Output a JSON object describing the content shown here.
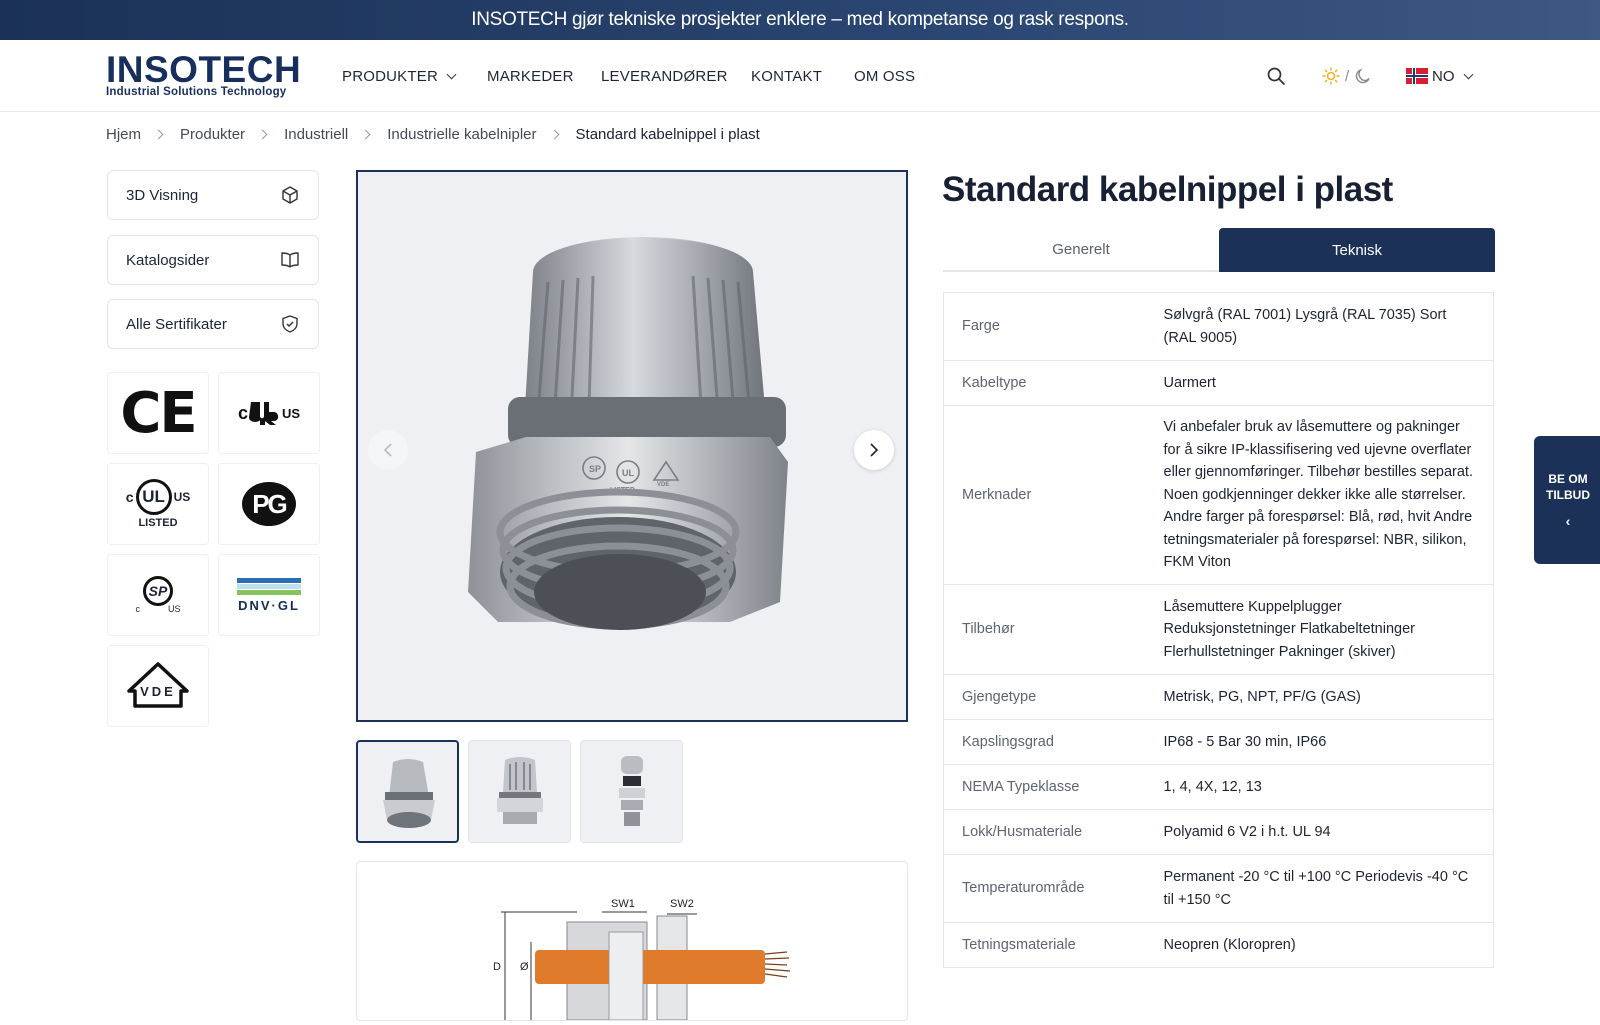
{
  "announcement": "INSOTECH gjør tekniske prosjekter enklere – med kompetanse og rask respons.",
  "logo": {
    "name": "INSOTECH",
    "tagline": "Industrial Solutions Technology"
  },
  "nav": {
    "products": "PRODUKTER",
    "markets": "MARKEDER",
    "suppliers": "LEVERANDØRER",
    "contact": "KONTAKT",
    "about": "OM OSS"
  },
  "theme_toggle": {
    "separator": "/"
  },
  "language": {
    "code": "NO"
  },
  "breadcrumb": [
    "Hjem",
    "Produkter",
    "Industriell",
    "Industrielle kabelnipler",
    "Standard kabelnippel i plast"
  ],
  "sidebar": {
    "view3d": "3D Visning",
    "catalog": "Katalogsider",
    "certificates": "Alle Sertifikater"
  },
  "certifications": {
    "ce": "CE",
    "ur_c": "c",
    "ur_us": "US",
    "ul_c": "c",
    "ul_mark": "UL",
    "ul_us": "US",
    "ul_listed": "LISTED",
    "pg": "PG",
    "csa_c": "c",
    "csa_mark": "SP",
    "csa_us": "US",
    "dnv": "DNV·GL",
    "vde": "VDE"
  },
  "product_image_stamps": {
    "csa": "SP",
    "ul": "UL",
    "listed": "LISTED",
    "vde": "VDE"
  },
  "drawing_labels": {
    "sw1": "SW1",
    "sw2": "SW2",
    "d": "D",
    "diameter": "Ø"
  },
  "product": {
    "title": "Standard kabelnippel i plast"
  },
  "tabs": {
    "general": "Generelt",
    "technical": "Teknisk"
  },
  "specs": [
    {
      "key": "Farge",
      "value": "Sølvgrå (RAL 7001) Lysgrå (RAL 7035) Sort (RAL 9005)"
    },
    {
      "key": "Kabeltype",
      "value": "Uarmert"
    },
    {
      "key": "Merknader",
      "value": "Vi anbefaler bruk av låsemuttere og pakninger for å sikre IP-klassifisering ved ujevne overflater eller gjennomføringer. Tilbehør bestilles separat. Noen godkjenninger dekker ikke alle størrelser. Andre farger på forespørsel: Blå, rød, hvit Andre tetningsmaterialer på forespørsel: NBR, silikon, FKM Viton"
    },
    {
      "key": "Tilbehør",
      "value": "Låsemuttere Kuppelplugger Reduksjonstetninger Flatkabeltetninger Flerhullstetninger Pakninger (skiver)"
    },
    {
      "key": "Gjengetype",
      "value": "Metrisk, PG, NPT, PF/G (GAS)"
    },
    {
      "key": "Kapslingsgrad",
      "value": "IP68 - 5 Bar 30 min, IP66"
    },
    {
      "key": "NEMA Typeklasse",
      "value": "1, 4, 4X, 12, 13"
    },
    {
      "key": "Lokk/Husmateriale",
      "value": "Polyamid 6 V2 i h.t. UL 94"
    },
    {
      "key": "Temperaturområde",
      "value": "Permanent -20 °C til +100 °C Periodevis -40 °C til +150 °C"
    },
    {
      "key": "Tetningsmateriale",
      "value": "Neopren (Kloropren)"
    }
  ],
  "quote_button": {
    "line1": "BE OM",
    "line2": "TILBUD",
    "arrow": "‹"
  },
  "colors": {
    "brand": "#1b3157",
    "border": "#e3e6ea",
    "sun": "#f2b21b"
  }
}
